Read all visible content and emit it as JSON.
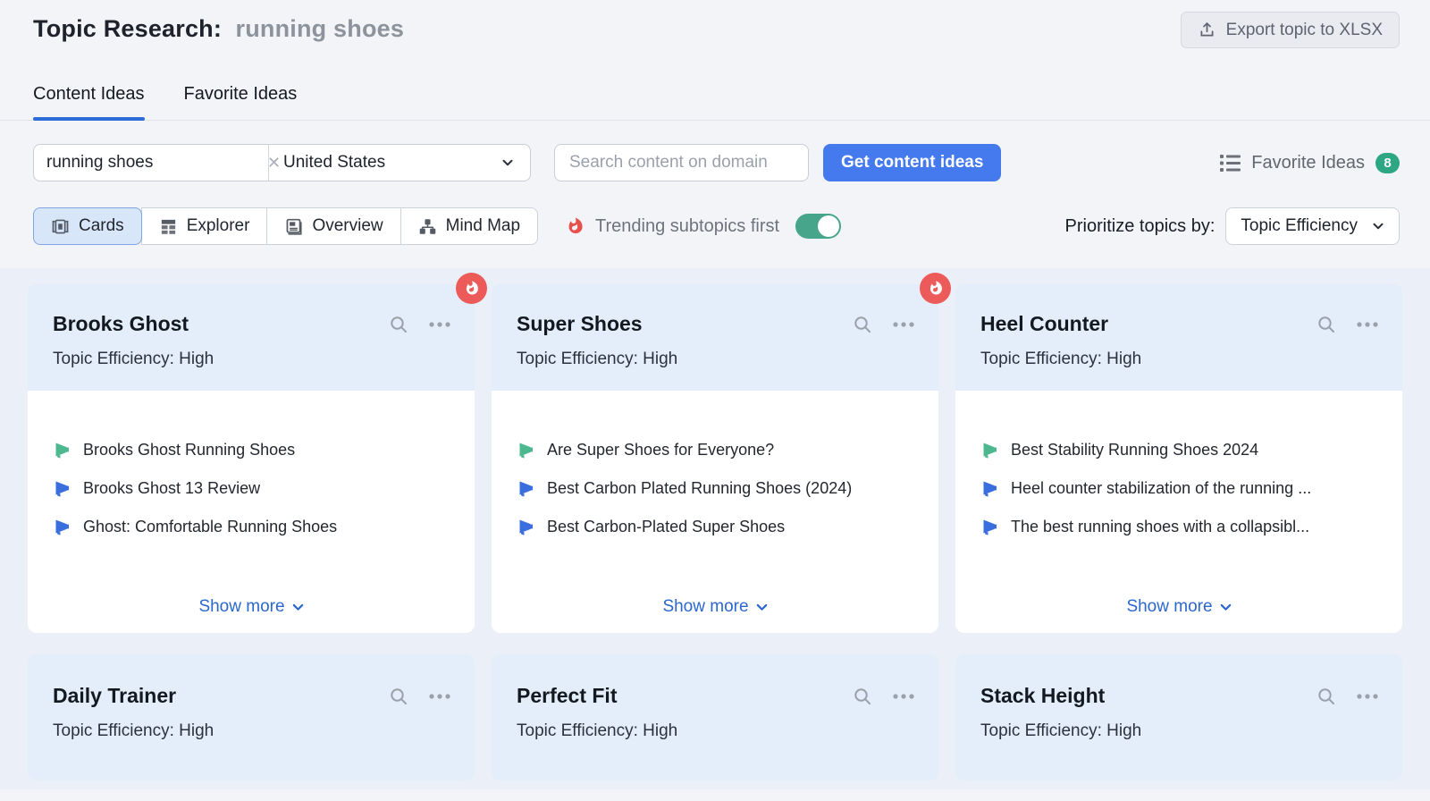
{
  "header": {
    "title": "Topic Research:",
    "query": "running shoes",
    "export_label": "Export topic to XLSX"
  },
  "tabs": [
    {
      "label": "Content Ideas",
      "active": true
    },
    {
      "label": "Favorite Ideas",
      "active": false
    }
  ],
  "search": {
    "query_value": "running shoes",
    "country": "United States",
    "domain_placeholder": "Search content on domain",
    "submit_label": "Get content ideas",
    "favorite_ideas_label": "Favorite Ideas",
    "favorite_count": "8"
  },
  "view_switcher": [
    {
      "label": "Cards",
      "active": true
    },
    {
      "label": "Explorer",
      "active": false
    },
    {
      "label": "Overview",
      "active": false
    },
    {
      "label": "Mind Map",
      "active": false
    }
  ],
  "controls": {
    "trending_label": "Trending subtopics first",
    "trending_on": true,
    "prioritize_label": "Prioritize topics by:",
    "prioritize_value": "Topic Efficiency"
  },
  "cards": [
    {
      "title": "Brooks Ghost",
      "efficiency": "Topic Efficiency: High",
      "trending": true,
      "headlines": [
        {
          "text": "Brooks Ghost Running Shoes",
          "icon": "green"
        },
        {
          "text": "Brooks Ghost 13 Review",
          "icon": "blue"
        },
        {
          "text": "Ghost: Comfortable Running Shoes",
          "icon": "blue"
        }
      ],
      "show_more": "Show more"
    },
    {
      "title": "Super Shoes",
      "efficiency": "Topic Efficiency: High",
      "trending": true,
      "headlines": [
        {
          "text": "Are Super Shoes for Everyone?",
          "icon": "green"
        },
        {
          "text": "Best Carbon Plated Running Shoes (2024)",
          "icon": "blue"
        },
        {
          "text": "Best Carbon-Plated Super Shoes",
          "icon": "blue"
        }
      ],
      "show_more": "Show more"
    },
    {
      "title": "Heel Counter",
      "efficiency": "Topic Efficiency: High",
      "trending": false,
      "headlines": [
        {
          "text": "Best Stability Running Shoes 2024",
          "icon": "green"
        },
        {
          "text": "Heel counter stabilization of the running ...",
          "icon": "blue"
        },
        {
          "text": "The best running shoes with a collapsibl...",
          "icon": "blue"
        }
      ],
      "show_more": "Show more"
    }
  ],
  "cards_row2": [
    {
      "title": "Daily Trainer",
      "efficiency": "Topic Efficiency: High"
    },
    {
      "title": "Perfect Fit",
      "efficiency": "Topic Efficiency: High"
    },
    {
      "title": "Stack Height",
      "efficiency": "Topic Efficiency: High"
    }
  ],
  "colors": {
    "accent_blue": "#4579ee",
    "tab_underline": "#2b6cd9",
    "toggle_green": "#47a58b",
    "badge_green": "#2da683",
    "fire_red": "#ec5b59",
    "megaphone_green": "#4db890",
    "megaphone_blue": "#3a6ede",
    "card_header_bg": "#e3eefa",
    "cards_area_bg": "#ebeff7"
  }
}
